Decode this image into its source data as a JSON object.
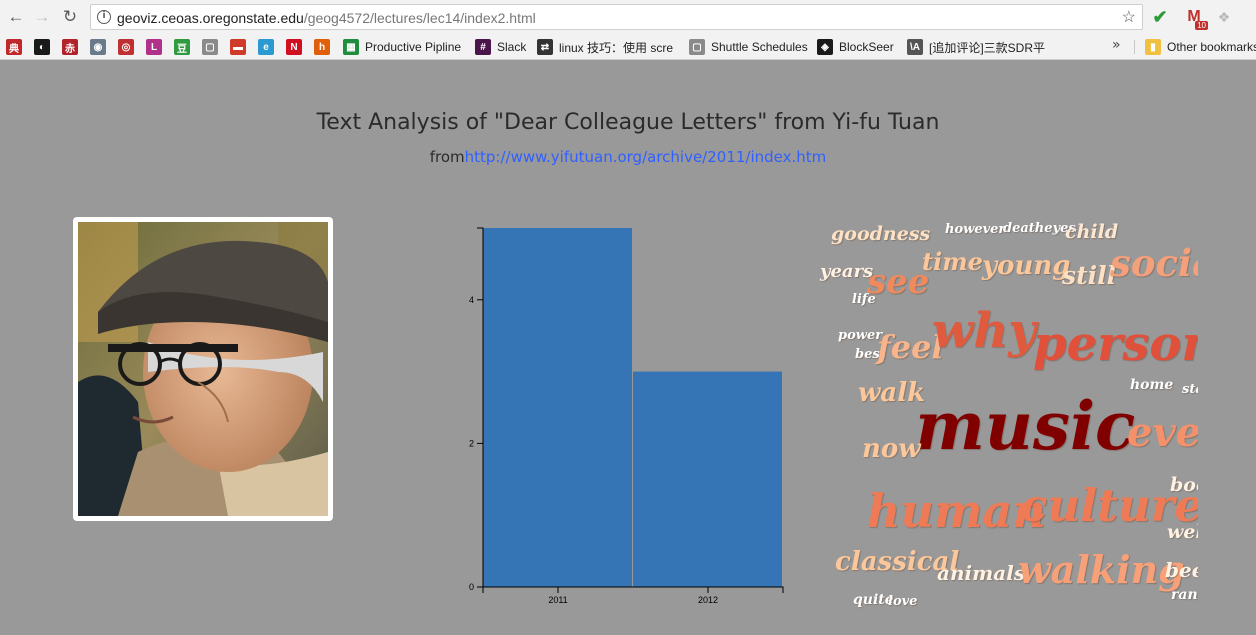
{
  "browser": {
    "url_host": "geoviz.ceoas.oregonstate.edu",
    "url_path": "/geog4572/lectures/lec14/index2.html",
    "extensions": {
      "gmail_count": "10"
    },
    "bookmarks": [
      {
        "icon_text": "典",
        "color": "#c0282c"
      },
      {
        "icon_text": "◐",
        "color": "#1a1a1a"
      },
      {
        "icon_text": "赤",
        "color": "#b2222a"
      },
      {
        "icon_text": "◉",
        "color": "#6a7a8a"
      },
      {
        "icon_text": "◎",
        "color": "#c03030"
      },
      {
        "icon_text": "L",
        "color": "#b0308a"
      },
      {
        "icon_text": "豆",
        "color": "#2f9a3f"
      },
      {
        "icon_text": "▢",
        "color": "#8a8a8a"
      },
      {
        "icon_text": "▬",
        "color": "#d03a2a"
      },
      {
        "icon_text": "e",
        "color": "#2a9ad0"
      },
      {
        "icon_text": "N",
        "color": "#d01020"
      },
      {
        "icon_text": "h",
        "color": "#e0600a"
      },
      {
        "icon_text": "▦",
        "color": "#1e8e3e",
        "label": "Productive Pipline"
      },
      {
        "icon_text": "#",
        "color": "#4a154b",
        "label": "Slack"
      },
      {
        "icon_text": "⇄",
        "color": "#333333",
        "label": "linux 技巧：使用 scre"
      },
      {
        "icon_text": "▢",
        "color": "#8a8a8a",
        "label": "Shuttle Schedules"
      },
      {
        "icon_text": "◈",
        "color": "#1a1a1a",
        "label": "BlockSeer"
      },
      {
        "icon_text": "\\A",
        "color": "#555555",
        "label": "[追加评论]三款SDR平"
      },
      {
        "icon_text": "▮",
        "color": "#f0c040",
        "label": "Other bookmarks"
      }
    ],
    "more_chevron": "»"
  },
  "page": {
    "title": "Text Analysis of \"Dear Colleague Letters\" from Yi-fu Tuan",
    "subtitle_prefix": "from",
    "subtitle_link": "http://www.yifutuan.org/archive/2011/index.htm"
  },
  "photo": {
    "subject": "portrait of an elderly man in a flat cap and glasses"
  },
  "chart_data": {
    "type": "bar",
    "categories": [
      "2011",
      "2012"
    ],
    "values": [
      5,
      3
    ],
    "ylim": [
      0,
      5
    ],
    "yticks": [
      0,
      2,
      4
    ],
    "bar_color": "#3575b5",
    "xlabel": "",
    "ylabel": "",
    "title": ""
  },
  "word_cloud": [
    {
      "text": "goodness",
      "color": "#ffe2c4"
    },
    {
      "text": "however",
      "color": "#ffffff"
    },
    {
      "text": "deatheyes",
      "color": "#ffffff"
    },
    {
      "text": "child",
      "color": "#ffe8d2"
    },
    {
      "text": "years",
      "color": "#fff2e2"
    },
    {
      "text": "see",
      "color": "#f08a5d"
    },
    {
      "text": "time",
      "color": "#fcc79a"
    },
    {
      "text": "young",
      "color": "#fcc79a"
    },
    {
      "text": "still",
      "color": "#fce0c4"
    },
    {
      "text": "social",
      "color": "#f4a07a"
    },
    {
      "text": "life",
      "color": "#ffffff"
    },
    {
      "text": "power",
      "color": "#ffffff"
    },
    {
      "text": "best",
      "color": "#ffffff"
    },
    {
      "text": "feel",
      "color": "#f8b48a"
    },
    {
      "text": "why",
      "color": "#e05a3e"
    },
    {
      "text": "person",
      "color": "#e0503a"
    },
    {
      "text": "home",
      "color": "#ffffff"
    },
    {
      "text": "sta",
      "color": "#ffffff"
    },
    {
      "text": "walk",
      "color": "#fcc79a"
    },
    {
      "text": "music",
      "color": "#800000"
    },
    {
      "text": "even",
      "color": "#f4916a"
    },
    {
      "text": "now",
      "color": "#fcc79a"
    },
    {
      "text": "boo",
      "color": "#fff2e2"
    },
    {
      "text": "human",
      "color": "#ee7a56"
    },
    {
      "text": "culture",
      "color": "#ee7a56"
    },
    {
      "text": "wel",
      "color": "#fff2e2"
    },
    {
      "text": "classical",
      "color": "#fcc79a"
    },
    {
      "text": "animals",
      "color": "#fff2e2"
    },
    {
      "text": "walking",
      "color": "#f8a078"
    },
    {
      "text": "bee",
      "color": "#fff2e2"
    },
    {
      "text": "quite",
      "color": "#ffffff"
    },
    {
      "text": "love",
      "color": "#ffffff"
    },
    {
      "text": "ran",
      "color": "#ffffff"
    }
  ]
}
